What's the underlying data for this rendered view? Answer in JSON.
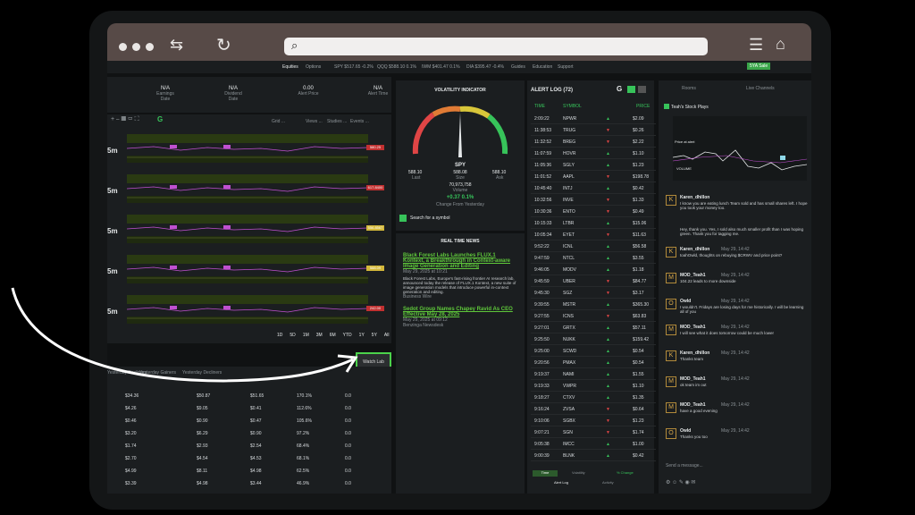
{
  "browser": {
    "title": "browser window"
  },
  "nav": {
    "tabs": [
      "Equities",
      "Options"
    ],
    "tickers": [
      "SPY $517.65 -0.2%",
      "QQQ $588.10 0.1%",
      "IWM $401.47 0.1%",
      "DIA $395.47 -0.4%"
    ],
    "links": [
      "Guides",
      "Education",
      "Support"
    ],
    "sale": "5YA Sale"
  },
  "stats": [
    {
      "value": "N/A",
      "label": "Earnings Date"
    },
    {
      "value": "N/A",
      "label": "Dividend Date"
    },
    {
      "value": "0.00",
      "label": "Alert Price"
    },
    {
      "value": "N/A",
      "label": "Alert Time"
    }
  ],
  "chart_toolbar": {
    "grid": "Grid ...",
    "views": "Views ...",
    "studies": "Studies ...",
    "events": "Events ..."
  },
  "charts": [
    {
      "interval": "5m",
      "price": "580.25"
    },
    {
      "interval": "5m",
      "price": "617.8400"
    },
    {
      "interval": "5m",
      "price": "556.8567"
    },
    {
      "interval": "5m",
      "price": "588.09"
    },
    {
      "interval": "5m",
      "price": "242.00"
    }
  ],
  "ranges": [
    "1D",
    "5D",
    "1M",
    "3M",
    "6M",
    "YTD",
    "1Y",
    "5Y",
    "All"
  ],
  "watch_btn": "Watch Lab",
  "movers_tabs": [
    "Yesterday Decliners",
    "Yesterday Gainers",
    "Yesterday Decliners"
  ],
  "movers": [
    [
      "$34.36",
      "$50.87",
      "$51.65",
      "170.1%",
      "0.0"
    ],
    [
      "$4.26",
      "$9.05",
      "$0.41",
      "112.6%",
      "0.0"
    ],
    [
      "$0.46",
      "$0.90",
      "$0.47",
      "105.6%",
      "0.0"
    ],
    [
      "$3.20",
      "$6.29",
      "$0.90",
      "97.2%",
      "0.0"
    ],
    [
      "$1.74",
      "$2.93",
      "$2.54",
      "68.4%",
      "0.0"
    ],
    [
      "$2.70",
      "$4.54",
      "$4.53",
      "68.1%",
      "0.0"
    ],
    [
      "$4.99",
      "$8.11",
      "$4.98",
      "62.5%",
      "0.0"
    ],
    [
      "$3.39",
      "$4.98",
      "$3.44",
      "46.9%",
      "0.0"
    ]
  ],
  "volatility": {
    "title": "VOLATILITY INDICATOR",
    "symbol": "SPY",
    "last": "588.08",
    "bid": "588.10",
    "ask": "588.10",
    "bid_label": "Last",
    "last_label": "Size",
    "ask_label": "Ask",
    "volume": "70,973,758",
    "vol_label": "Volume",
    "change": "+0.37  0.1%",
    "change_label": "Change From Yesterday",
    "search": "Search for a symbol"
  },
  "news": {
    "title": "REAL TIME NEWS",
    "items": [
      {
        "headline": "Black Forest Labs Launches FLUX.1 Kontext, a Breakthrough in Context-aware Image Generation and Editing",
        "date": "May 29, 2025 at 10:21",
        "body": "Black Forest Labs, Europe's fast-rising frontier AI research lab, announced today the release of FLUX.1 Kontext, a new suite of image generation models that introduce powerful in-context generation and editing.",
        "source": "Business Wire"
      },
      {
        "headline": "Sedot Group Names Chapey Ravid As CEO Effective May 28, 2025",
        "date": "May 29, 2025 at 09:12",
        "source": "Benzinga Newsdesk"
      }
    ]
  },
  "alert_log": {
    "title": "ALERT LOG (72)",
    "headers": [
      "TIME",
      "SYMBOL",
      "",
      "PRICE"
    ],
    "rows": [
      [
        "2:09:22",
        "NPWR",
        "g",
        "$2.09"
      ],
      [
        "11:38:53",
        "TRUG",
        "r",
        "$0.26"
      ],
      [
        "11:32:52",
        "BREG",
        "r",
        "$2.22"
      ],
      [
        "11:07:59",
        "HOVR",
        "g",
        "$1.10"
      ],
      [
        "11:05:36",
        "SGLY",
        "g",
        "$1.23"
      ],
      [
        "11:01:52",
        "AAPL",
        "r",
        "$198.78"
      ],
      [
        "10:45:40",
        "INTJ",
        "g",
        "$0.42"
      ],
      [
        "10:32:56",
        "INVE",
        "r",
        "$1.33"
      ],
      [
        "10:30:36",
        "ENTO",
        "r",
        "$0.49"
      ],
      [
        "10:15:33",
        "LTBR",
        "g",
        "$15.06"
      ],
      [
        "10:05:34",
        "EYET",
        "r",
        "$11.63"
      ],
      [
        "9:52:22",
        "ICNL",
        "g",
        "$56.58"
      ],
      [
        "9:47:59",
        "NTCL",
        "g",
        "$3.55"
      ],
      [
        "9:46:05",
        "MODV",
        "g",
        "$1.18"
      ],
      [
        "9:45:59",
        "UBER",
        "r",
        "$84.77"
      ],
      [
        "9:45:30",
        "SGZ",
        "r",
        "$3.17"
      ],
      [
        "9:39:55",
        "MSTR",
        "g",
        "$365.30"
      ],
      [
        "9:27:55",
        "ICNS",
        "r",
        "$63.83"
      ],
      [
        "9:27:01",
        "GRTX",
        "g",
        "$57.11"
      ],
      [
        "9:25:50",
        "NUKK",
        "g",
        "$159.42"
      ],
      [
        "9:25:00",
        "SCWD",
        "g",
        "$0.54"
      ],
      [
        "9:20:56",
        "PMAX",
        "g",
        "$0.54"
      ],
      [
        "9:19:37",
        "NAMI",
        "g",
        "$1.55"
      ],
      [
        "9:19:33",
        "VWPR",
        "g",
        "$1.10"
      ],
      [
        "9:18:27",
        "CTXV",
        "g",
        "$1.35"
      ],
      [
        "9:16:24",
        "ZVSA",
        "r",
        "$0.64"
      ],
      [
        "9:10:06",
        "SGBX",
        "r",
        "$1.23"
      ],
      [
        "9:07:21",
        "SGN",
        "r",
        "$1.74"
      ],
      [
        "9:05:38",
        "IMCC",
        "g",
        "$1.00"
      ],
      [
        "9:00:39",
        "BLNK",
        "g",
        "$0.42"
      ]
    ],
    "filters": [
      "Time",
      "Volatility",
      "% Change"
    ],
    "bottom_tabs": [
      "Alert Log",
      "Activity"
    ]
  },
  "chat": {
    "tabs": [
      "Rooms",
      "Live Channels"
    ],
    "room": "Teah's Stock Plays",
    "price_label": "Price at alert",
    "volume_label": "VOLUME",
    "messages": [
      {
        "user": "Karen_dhillon",
        "text": "I know you are eating lunch Team sold and has small shares left. I hope you took your money too."
      },
      {
        "user": "",
        "text": "Hey, thank you. Yes, I sold also much smaller profit than I was hoping green. Thank you for tagging me."
      },
      {
        "user": "Karen_dhillon",
        "time": "May 29, 14:42",
        "text": "toahOwld, thoughts on rebuying $CRWV and price point?"
      },
      {
        "user": "MOD_Teah1",
        "time": "May 29, 14:42",
        "text": "104.22 leads to more downside"
      },
      {
        "user": "Owld",
        "time": "May 29, 14:42",
        "text": "I wouldn't. Fridays are losing days for me historically. I will be learning all of you"
      },
      {
        "user": "MOD_Teah1",
        "time": "May 29, 14:42",
        "text": "I will see what it does tomorrow could be much lower"
      },
      {
        "user": "Karen_dhillon",
        "time": "May 29, 14:42",
        "text": "Thanks team"
      },
      {
        "user": "MOD_Teah1",
        "time": "May 29, 14:42",
        "text": "ok team im out"
      },
      {
        "user": "MOD_Teah1",
        "time": "May 29, 14:42",
        "text": "have a good evening"
      },
      {
        "user": "Owld",
        "time": "May 29, 14:42",
        "text": "Thanks you too"
      }
    ],
    "input_placeholder": "Send a message..."
  }
}
